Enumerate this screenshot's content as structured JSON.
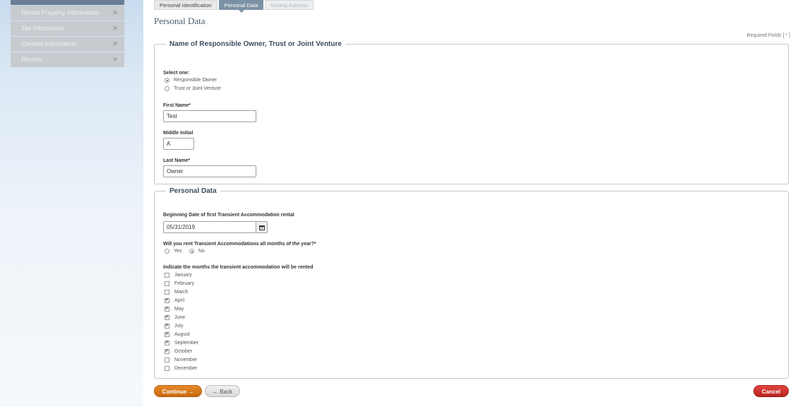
{
  "sidebar": {
    "items": [
      {
        "label": "Rental Property Information"
      },
      {
        "label": "Tax Information"
      },
      {
        "label": "Contact Information"
      },
      {
        "label": "Review"
      }
    ],
    "chevron": ">"
  },
  "tabs": [
    {
      "label": "Personal Identification",
      "state": "normal"
    },
    {
      "label": "Personal Data",
      "state": "active"
    },
    {
      "label": "Mailing Address",
      "state": "disabled"
    }
  ],
  "page_title": "Personal Data",
  "required_note": "Required Fields [ * ]",
  "owner_section": {
    "legend": "Name of Responsible Owner, Trust or Joint Venture",
    "select_label": "Select one:",
    "options": [
      {
        "label": "Responsible Owner",
        "selected": true
      },
      {
        "label": "Trust or Joint Venture",
        "selected": false
      }
    ],
    "first_name_label": "First Name*",
    "first_name_value": "Test",
    "middle_initial_label": "Middle Initial",
    "middle_initial_value": "A",
    "last_name_label": "Last Name*",
    "last_name_value": "Owner"
  },
  "personal_section": {
    "legend": "Personal Data",
    "begin_date_label": "Beginning Date of first Transient Accommodation rental",
    "begin_date_value": "05/31/2019",
    "all_months_label": "Will you rent Transient Accommodations all months of the year?*",
    "all_months_options": [
      {
        "label": "Yes",
        "selected": false
      },
      {
        "label": "No",
        "selected": true
      }
    ],
    "months_label": "Indicate the months the transient accommodation will be rented",
    "months": [
      {
        "label": "January",
        "checked": false
      },
      {
        "label": "February",
        "checked": false
      },
      {
        "label": "March",
        "checked": false
      },
      {
        "label": "April",
        "checked": true
      },
      {
        "label": "May",
        "checked": true
      },
      {
        "label": "June",
        "checked": true
      },
      {
        "label": "July",
        "checked": true
      },
      {
        "label": "August",
        "checked": true
      },
      {
        "label": "September",
        "checked": true
      },
      {
        "label": "October",
        "checked": true
      },
      {
        "label": "November",
        "checked": false
      },
      {
        "label": "December",
        "checked": false
      }
    ]
  },
  "buttons": {
    "continue": "Continue →",
    "back": "← Back",
    "cancel": "Cancel"
  },
  "icons": {
    "calendar": "calendar-icon",
    "check_glyph": "✔"
  },
  "colors": {
    "continue": "#d97a1c",
    "cancel": "#c9302c",
    "tab_active": "#7d91a6"
  }
}
